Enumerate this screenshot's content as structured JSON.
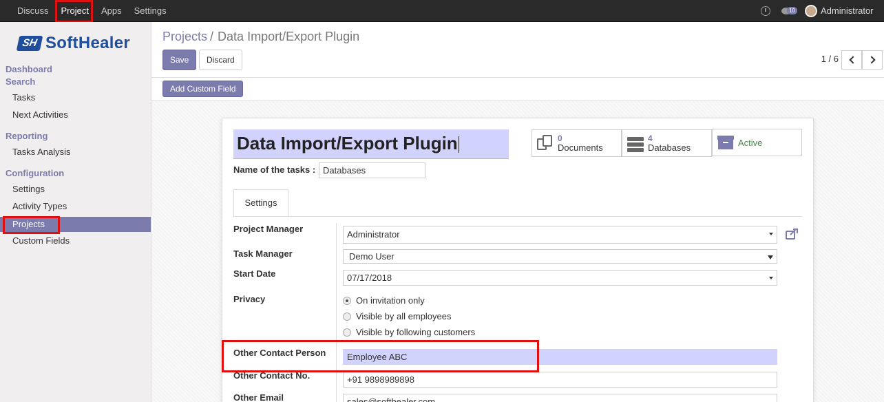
{
  "topbar": {
    "menu": [
      "Discuss",
      "Project",
      "Apps",
      "Settings"
    ],
    "active_index": 1,
    "chat_badge": "10",
    "username": "Administrator"
  },
  "sidebar": {
    "logo_mark": "SH",
    "logo_text": "SoftHealer",
    "dashboard": "Dashboard",
    "search": "Search",
    "tasks": "Tasks",
    "next_activities": "Next Activities",
    "reporting": "Reporting",
    "tasks_analysis": "Tasks Analysis",
    "configuration": "Configuration",
    "settings": "Settings",
    "activity_types": "Activity Types",
    "projects": "Projects",
    "custom_fields": "Custom Fields"
  },
  "control": {
    "breadcrumb_parent": "Projects",
    "breadcrumb_sep": "/",
    "breadcrumb_current": "Data Import/Export Plugin",
    "save_label": "Save",
    "discard_label": "Discard",
    "pager": "1 / 6",
    "add_custom_field": "Add Custom Field"
  },
  "form": {
    "title": "Data Import/Export Plugin",
    "stats": {
      "documents_count": "0",
      "documents_label": "Documents",
      "databases_count": "4",
      "databases_label": "Databases",
      "active_label": "Active"
    },
    "name_of_tasks_label": "Name of the tasks :",
    "name_of_tasks_value": "Databases",
    "tab_settings": "Settings",
    "project_manager_label": "Project Manager",
    "project_manager_value": "Administrator",
    "task_manager_label": "Task Manager",
    "task_manager_value": "Demo User",
    "start_date_label": "Start Date",
    "start_date_value": "07/17/2018",
    "privacy_label": "Privacy",
    "privacy_options": [
      "On invitation only",
      "Visible by all employees",
      "Visible by following customers"
    ],
    "privacy_selected": 0,
    "other_contact_person_label": "Other Contact Person",
    "other_contact_person_value": "Employee ABC",
    "other_contact_no_label": "Other Contact No.",
    "other_contact_no_value": "+91 9898989898",
    "other_email_label": "Other Email",
    "other_email_value": "sales@softhealer.com"
  },
  "colors": {
    "accent": "#7c7bad",
    "highlight": "#e01010",
    "title_bg": "#d2d2ff"
  }
}
